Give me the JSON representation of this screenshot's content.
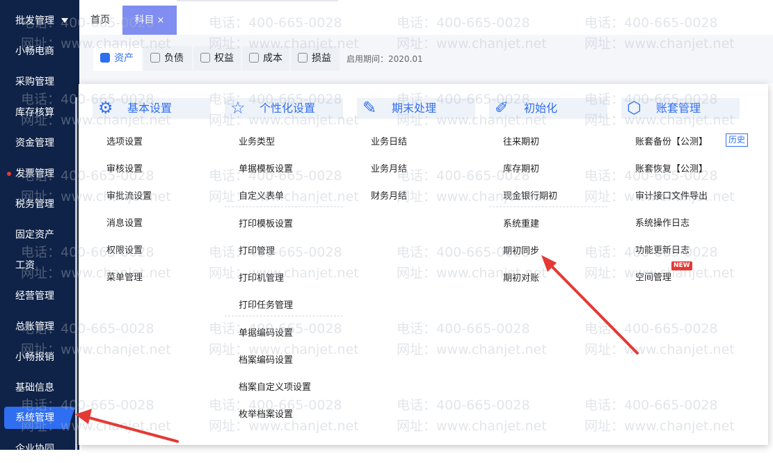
{
  "sidebar": {
    "items": [
      {
        "label": "批发管理"
      },
      {
        "label": "小畅电商"
      },
      {
        "label": "采购管理"
      },
      {
        "label": "库存核算"
      },
      {
        "label": "资金管理"
      },
      {
        "label": "发票管理"
      },
      {
        "label": "税务管理"
      },
      {
        "label": "固定资产"
      },
      {
        "label": "工资"
      },
      {
        "label": "经营管理"
      },
      {
        "label": "总账管理"
      },
      {
        "label": "小畅报销"
      },
      {
        "label": "基础信息"
      },
      {
        "label": "系统管理"
      },
      {
        "label": "企业协同"
      }
    ]
  },
  "tabs": {
    "home": "首页",
    "kemu": "科目",
    "close": "×"
  },
  "account_tabs": [
    "资产",
    "负债",
    "权益",
    "成本",
    "损益"
  ],
  "period": "启用期间：2020.01",
  "menu": {
    "columns": [
      {
        "title": "基本设置",
        "items": [
          "选项设置",
          "审核设置",
          "审批流设置",
          "消息设置",
          "权限设置",
          "菜单管理"
        ]
      },
      {
        "title": "个性化设置",
        "items": [
          "业务类型",
          "单据模板设置",
          "自定义表单",
          "打印模板设置",
          "打印管理",
          "打印机管理",
          "打印任务管理",
          "单据编码设置",
          "档案编码设置",
          "档案自定义项设置",
          "枚举档案设置"
        ]
      },
      {
        "title": "期末处理",
        "items": [
          "业务日结",
          "业务月结",
          "财务月结"
        ]
      },
      {
        "title": "初始化",
        "items": [
          "往来期初",
          "库存期初",
          "现金银行期初",
          "系统重建",
          "期初同步",
          "期初对账"
        ]
      },
      {
        "title": "账套管理",
        "items": [
          "账套备份【公测】",
          "账套恢复【公测】",
          "审计接口文件导出",
          "系统操作日志",
          "功能更新日志",
          "空间管理"
        ]
      }
    ],
    "history_label": "历史",
    "new_badge": "NEW"
  },
  "watermark": {
    "phone": "电话：400-665-0028",
    "site": "网址：www.chanjet.net"
  },
  "colors": {
    "sidebar": "#0f2247",
    "accent": "#2f6ef0",
    "arrow": "#e53935"
  }
}
